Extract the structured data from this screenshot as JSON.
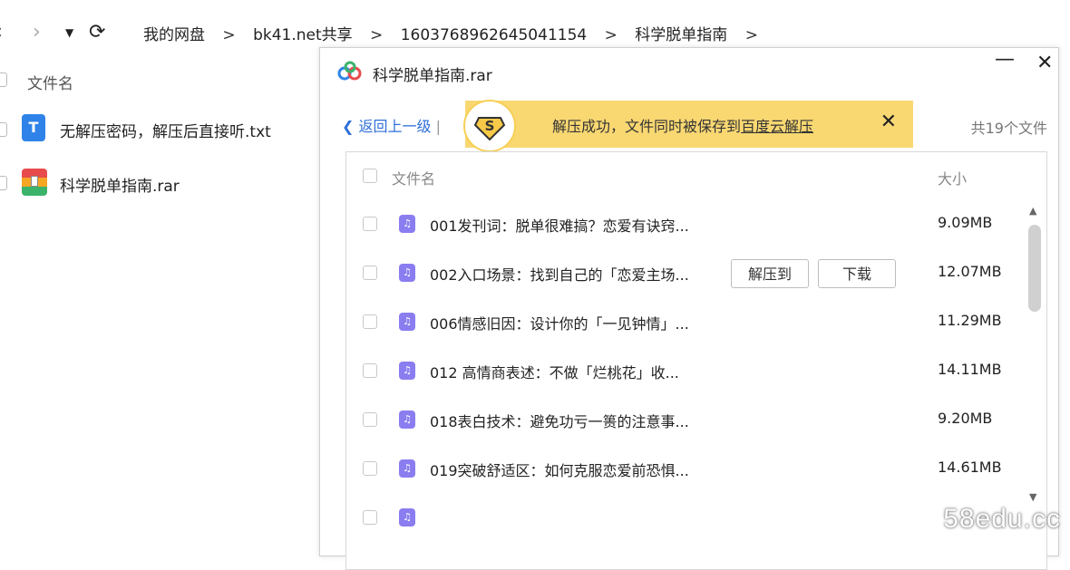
{
  "nav": {
    "breadcrumbs": [
      "我的网盘",
      "bk41.net共享",
      "1603768962645041154",
      "科学脱单指南"
    ],
    "separator": ">"
  },
  "left": {
    "header": "文件名",
    "files": [
      {
        "name": "无解压密码，解压后直接听.txt",
        "icon": "txt-file-icon"
      },
      {
        "name": "科学脱单指南.rar",
        "icon": "rar-archive-icon"
      }
    ]
  },
  "dialog": {
    "title": "科学脱单指南.rar",
    "back_label": "返回上一级",
    "back_sep": "|",
    "count": "共19个文件",
    "toast": {
      "text": "解压成功，文件同时被保存到",
      "link": "百度云解压",
      "badge": "S"
    },
    "columns": {
      "name": "文件名",
      "size": "大小"
    },
    "row_actions": {
      "extract": "解压到",
      "download": "下载"
    },
    "rows": [
      {
        "name": "001发刊词：脱单很难搞？恋爱有诀窍...",
        "size": "9.09MB"
      },
      {
        "name": "002入口场景：找到自己的「恋爱主场...",
        "size": "12.07MB"
      },
      {
        "name": "006情感旧因：设计你的「一见钟情」...",
        "size": "11.29MB"
      },
      {
        "name": "012 高情商表述：不做「烂桃花」收...",
        "size": "14.11MB"
      },
      {
        "name": "018表白技术：避免功亏一篑的注意事...",
        "size": "9.20MB"
      },
      {
        "name": "019突破舒适区：如何克服恋爱前恐惧...",
        "size": "14.61MB"
      }
    ]
  },
  "watermark": "58edu.cc",
  "colors": {
    "accent": "#2f6fd8",
    "toast": "#f9d872",
    "file_icon": "#8a7df0"
  }
}
